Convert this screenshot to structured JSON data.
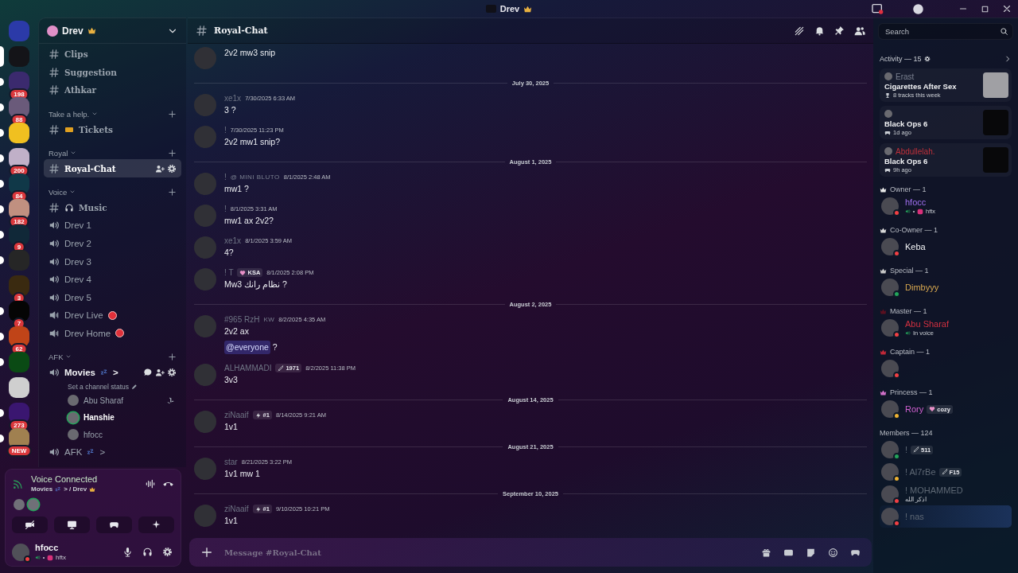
{
  "title_bar": {
    "title": "Drev"
  },
  "servers": [
    {
      "color": "#2b3aa8",
      "selected": false,
      "unread": false
    },
    {
      "color": "#141418",
      "selected": true,
      "unread": false
    },
    {
      "color": "#3b2a6e",
      "selected": false,
      "unread": true,
      "badge": "198"
    },
    {
      "color": "#6a5a7a",
      "selected": false,
      "unread": true,
      "badge": "88"
    },
    {
      "color": "#f0c020",
      "selected": false,
      "unread": true
    },
    {
      "color": "#c0b0c8",
      "selected": false,
      "unread": true,
      "badge": "200"
    },
    {
      "color": "#103848",
      "selected": false,
      "unread": true,
      "badge": "84"
    },
    {
      "color": "#c09080",
      "selected": false,
      "unread": true,
      "badge": "182"
    },
    {
      "color": "#102838",
      "selected": false,
      "unread": true,
      "badge": "9"
    },
    {
      "color": "#262626",
      "selected": false,
      "unread": true
    },
    {
      "color": "#3a2a10",
      "selected": false,
      "unread": false,
      "badge": "3"
    },
    {
      "color": "#050505",
      "selected": false,
      "unread": true,
      "badge": "7"
    },
    {
      "color": "#c04418",
      "selected": false,
      "unread": true,
      "badge": "62"
    },
    {
      "color": "#0a4a14",
      "selected": false,
      "unread": true
    },
    {
      "color": "#cfcfcf",
      "selected": false,
      "unread": false
    },
    {
      "color": "#3a1670",
      "selected": false,
      "unread": true,
      "badge": "273"
    },
    {
      "color": "#a08050",
      "selected": false,
      "unread": true,
      "badge": "NEW"
    }
  ],
  "server": {
    "name": "Drev"
  },
  "channel_groups": [
    {
      "channels": [
        {
          "kind": "text",
          "name": "Clips",
          "selected": false
        },
        {
          "kind": "text",
          "name": "Suggestion",
          "selected": false
        },
        {
          "kind": "text",
          "name": "Athkar",
          "selected": false
        }
      ]
    },
    {
      "name": "Take a help.",
      "channels": [
        {
          "kind": "ticket",
          "name": "Tickets",
          "selected": false
        }
      ]
    },
    {
      "name": "Royal",
      "channels": [
        {
          "kind": "text",
          "name": "Royal-Chat",
          "selected": true
        }
      ]
    },
    {
      "name": "Voice",
      "channels": [
        {
          "kind": "music",
          "name": "Music",
          "selected": false
        },
        {
          "kind": "voice",
          "name": "Drev 1",
          "selected": false
        },
        {
          "kind": "voice",
          "name": "Drev 2",
          "selected": false
        },
        {
          "kind": "voice",
          "name": "Drev 3",
          "selected": false
        },
        {
          "kind": "voice",
          "name": "Drev 4",
          "selected": false
        },
        {
          "kind": "voice",
          "name": "Drev 5",
          "selected": false
        },
        {
          "kind": "stage",
          "name": "Drev Live",
          "selected": false,
          "live": true
        },
        {
          "kind": "stage",
          "name": "Drev Home",
          "selected": false,
          "live": true
        }
      ]
    },
    {
      "name": "AFK",
      "channels": [
        {
          "kind": "voice",
          "name": "Movies",
          "suffix": ">",
          "selected": false,
          "connected": true,
          "status": "Set a channel status",
          "users": [
            {
              "name": "Abu Sharaf",
              "speaking": false,
              "console": true
            },
            {
              "name": "Hanshie",
              "speaking": true,
              "console": false
            },
            {
              "name": "hfocc",
              "speaking": false,
              "console": false
            }
          ]
        },
        {
          "kind": "voice",
          "name": "AFK",
          "suffix": ">",
          "selected": false,
          "connected": false
        }
      ]
    }
  ],
  "voice_panel": {
    "status": "Voice Connected",
    "channel": "Movies",
    "path": "> / Drev",
    "participants": [
      {
        "speaking": false
      },
      {
        "speaking": true
      }
    ]
  },
  "user": {
    "name": "hfocc",
    "status": {
      "color": "#f23f43"
    },
    "activity": "hftx"
  },
  "chat": {
    "channel": "Royal-Chat",
    "placeholder": "Message #Royal-Chat",
    "items": [
      {
        "kind": "message",
        "lines": [
          {
            "text": "2v2 mw3 snip"
          }
        ]
      },
      {
        "kind": "divider",
        "label": "July 30, 2025"
      },
      {
        "kind": "message",
        "author": "xe1x",
        "time": "7/30/2025 6:33 AM",
        "lines": [
          {
            "text": "3 ?"
          }
        ]
      },
      {
        "kind": "message",
        "author": "!",
        "time": "7/30/2025 11:23 PM",
        "lines": [
          {
            "text": "2v2 mw1 snip?"
          }
        ]
      },
      {
        "kind": "divider",
        "label": "August 1, 2025"
      },
      {
        "kind": "message",
        "author": "!",
        "guild_tag": "@ MINI BLUTO",
        "time": "8/1/2025 2:48 AM",
        "lines": [
          {
            "text": "mw1 ?"
          }
        ]
      },
      {
        "kind": "message",
        "author": "!",
        "time": "8/1/2025 3:31 AM",
        "lines": [
          {
            "text": "mw1 ax 2v2?"
          }
        ]
      },
      {
        "kind": "message",
        "author": "xe1x",
        "time": "8/1/2025 3:59 AM",
        "lines": [
          {
            "text": "4?"
          }
        ]
      },
      {
        "kind": "message",
        "author": "! T",
        "tag": {
          "kind": "heart",
          "label": "KSA"
        },
        "time": "8/1/2025 2:08 PM",
        "lines": [
          {
            "text": "Mw3 نظام رانك ?"
          }
        ]
      },
      {
        "kind": "divider",
        "label": "August 2, 2025"
      },
      {
        "kind": "message",
        "author": "#965 RzH",
        "guild_tag": "KW",
        "time": "8/2/2025 4:35 AM",
        "lines": [
          {
            "text": "2v2 ax"
          },
          {
            "mention": "@everyone",
            "text": "?"
          }
        ]
      },
      {
        "kind": "message",
        "author": "ALHAMMADI",
        "tag": {
          "kind": "sword",
          "label": "1971"
        },
        "time": "8/2/2025 11:38 PM",
        "lines": [
          {
            "text": "3v3"
          }
        ]
      },
      {
        "kind": "divider",
        "label": "August 14, 2025"
      },
      {
        "kind": "message",
        "author": "ziNaaif",
        "tag": {
          "kind": "bolt",
          "label": "#1"
        },
        "time": "8/14/2025 9:21 AM",
        "lines": [
          {
            "text": "1v1"
          }
        ]
      },
      {
        "kind": "divider",
        "label": "August 21, 2025"
      },
      {
        "kind": "message",
        "author": "star",
        "time": "8/21/2025 3:22 PM",
        "lines": [
          {
            "text": "1v1 mw 1"
          }
        ]
      },
      {
        "kind": "divider",
        "label": "September 10, 2025"
      },
      {
        "kind": "message",
        "author": "ziNaaif",
        "tag": {
          "kind": "bolt",
          "label": "#1"
        },
        "time": "9/10/2025 10:21 PM",
        "lines": [
          {
            "text": "1v1"
          }
        ]
      }
    ]
  },
  "members_panel": {
    "search": {
      "placeholder": "Search"
    },
    "activity": {
      "title": "Activity — 15",
      "cards": [
        {
          "kind": "music",
          "user": {
            "name": "Erast"
          },
          "title": "Cigarettes After Sex",
          "detail": "8 tracks this week"
        },
        {
          "kind": "game",
          "title": "Black Ops 6",
          "detail": "1d ago"
        },
        {
          "kind": "game",
          "user": {
            "name": "Abdullelah.",
            "color": "#c0303a"
          },
          "title": "Black Ops 6",
          "detail": "9h ago"
        }
      ]
    },
    "roles": [
      {
        "name": "Owner — 1",
        "color": "#e8e8e8",
        "members": [
          {
            "name": "hfocc",
            "color": "#a070f0",
            "status": {
              "color": "#f23f43"
            },
            "activity": {
              "kind": "instagram",
              "text": "hftx"
            }
          }
        ]
      },
      {
        "name": "Co-Owner — 1",
        "color": "#d8d8d8",
        "members": [
          {
            "name": "Keba",
            "color": "#f2f3f5",
            "status": {
              "color": "#f23f43"
            }
          }
        ]
      },
      {
        "name": "Special — 1",
        "color": "#c8c8c8",
        "members": [
          {
            "name": "Dimbyyy",
            "color": "#d8a850",
            "status": {
              "color": "#23a55a"
            }
          }
        ]
      },
      {
        "name": "Master — 1",
        "color": "#5a1020",
        "members": [
          {
            "name": "Abu Sharaf",
            "color": "#d03040",
            "status": {
              "color": "#f23f43"
            },
            "activity": {
              "kind": "voice",
              "text": "In voice"
            }
          }
        ]
      },
      {
        "name": "Captain — 1",
        "color": "#c02838",
        "members": [
          {
            "status": {
              "color": "#f23f43"
            }
          }
        ]
      },
      {
        "name": "Princess — 1",
        "color": "#d070c8",
        "members": [
          {
            "name": "Rory",
            "color": "#d060d0",
            "status": {
              "color": "#f0b232"
            },
            "tag": {
              "kind": "heart",
              "label": "cozy"
            }
          }
        ]
      },
      {
        "name": "Members — 124",
        "members": [
          {
            "name": "!",
            "color": "#5e6874",
            "status": {
              "color": "#23a55a"
            },
            "tag": {
              "kind": "sword",
              "label": "511"
            }
          },
          {
            "name": "! Al7rBe",
            "color": "#5e6874",
            "status": {
              "color": "#f0b232"
            },
            "tag": {
              "kind": "sword",
              "label": "F15"
            }
          },
          {
            "name": "! MOHAMMED",
            "color": "#5e6874",
            "status": {
              "color": "#f23f43"
            },
            "activity": {
              "kind": "plain",
              "text": "اذكر الله"
            }
          },
          {
            "name": "! nas",
            "color": "#5e6874",
            "status": {
              "color": "#f23f43"
            },
            "banner": true
          }
        ]
      }
    ]
  }
}
